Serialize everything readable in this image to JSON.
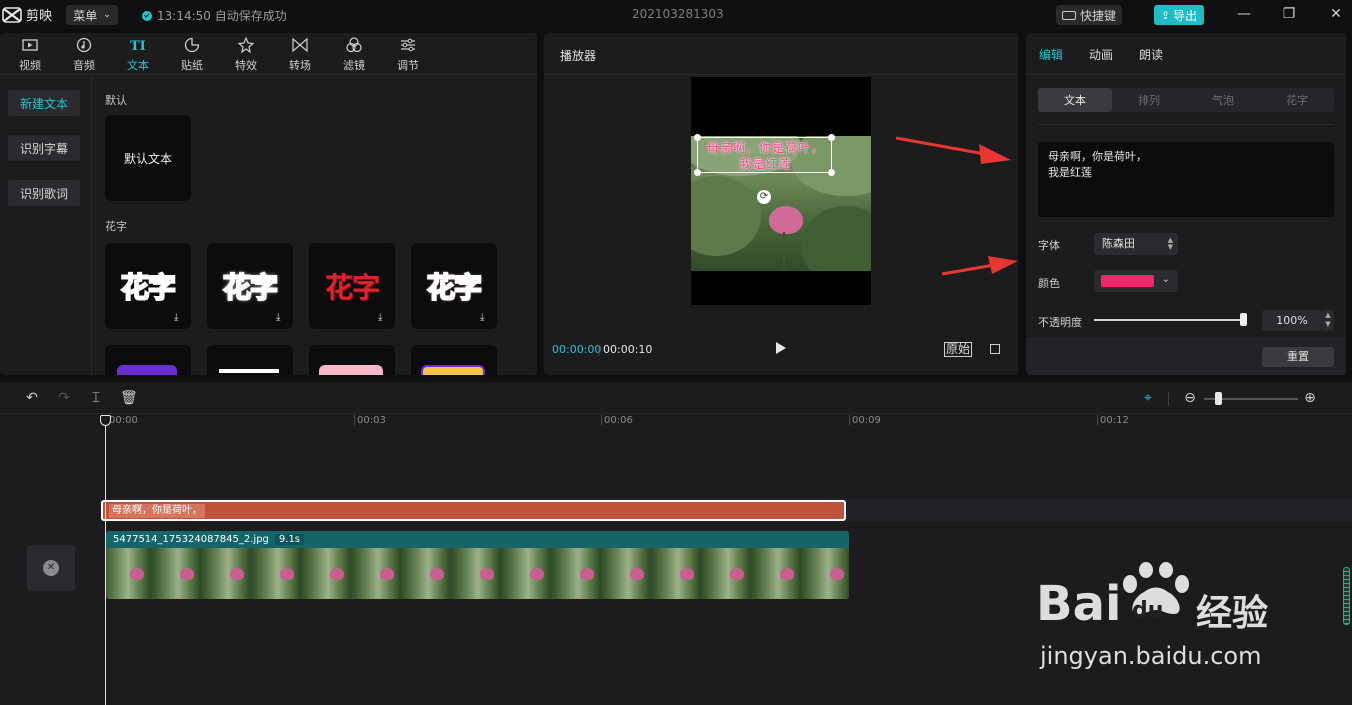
{
  "app": {
    "name": "剪映",
    "menu_label": "菜单",
    "save_status": "13:14:50 自动保存成功",
    "project_name": "202103281303",
    "shortcut_label": "快捷键",
    "export_label": "导出"
  },
  "library": {
    "tabs": [
      {
        "label": "视频",
        "icon": "video-icon"
      },
      {
        "label": "音频",
        "icon": "audio-icon"
      },
      {
        "label": "文本",
        "icon": "text-icon"
      },
      {
        "label": "贴纸",
        "icon": "sticker-icon"
      },
      {
        "label": "特效",
        "icon": "effects-icon"
      },
      {
        "label": "转场",
        "icon": "transition-icon"
      },
      {
        "label": "滤镜",
        "icon": "filter-icon"
      },
      {
        "label": "调节",
        "icon": "adjust-icon"
      }
    ],
    "active_tab": "文本",
    "side_buttons": [
      "新建文本",
      "识别字幕",
      "识别歌词"
    ],
    "section_default": "默认",
    "default_tile": "默认文本",
    "section_fancy": "花字",
    "fancy_tiles": [
      "花字",
      "花字",
      "花字",
      "花字"
    ]
  },
  "player": {
    "title": "播放器",
    "overlay_line1": "母亲啊，你是荷叶，",
    "overlay_line2": "我是红莲",
    "current_time": "00:00:00",
    "total_time": "00:00:10",
    "original_label": "原始"
  },
  "properties": {
    "tabs": [
      "编辑",
      "动画",
      "朗读"
    ],
    "subtabs": [
      "文本",
      "排列",
      "气泡",
      "花字"
    ],
    "text_content": "母亲啊，你是荷叶，\n我是红莲",
    "font_label": "字体",
    "font_value": "陈森田",
    "color_label": "颜色",
    "color_value": "#f2266a",
    "opacity_label": "不透明度",
    "opacity_value": "100%",
    "opacity": 1.0,
    "reset_label": "重置"
  },
  "timeline": {
    "ruler": [
      "00:00",
      "00:03",
      "00:06",
      "00:09",
      "00:12"
    ],
    "text_clip_label": "母亲啊，你是荷叶，",
    "video_clip_name": "5477514_175324087845_2.jpg",
    "video_clip_duration": "9.1s"
  },
  "watermark": {
    "brand": "Bai",
    "brand2": "du",
    "brand3": "经验",
    "url": "jingyan.baidu.com"
  },
  "colors": {
    "accent": "#25c4ce",
    "text_clip": "#c0513d",
    "video_clip": "#1b6f74",
    "annotation_arrow": "#e8372f"
  }
}
